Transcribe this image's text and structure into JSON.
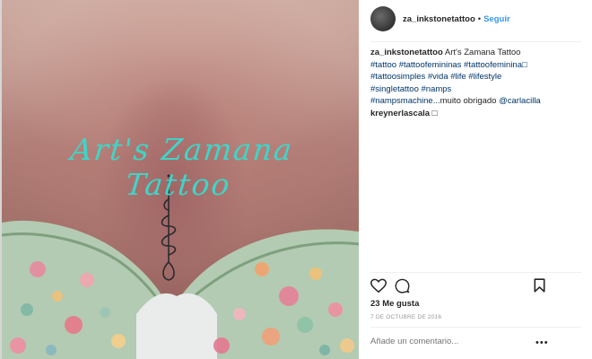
{
  "post": {
    "username": "za_inkstonetattoo",
    "separator": "•",
    "follow_label": "Seguir",
    "image_watermark": "Art's Zamana Tattoo",
    "caption": {
      "username": "za_inkstonetattoo",
      "text": "Art's Zamana Tattoo",
      "hashtags_line1": "#tattoo #tattoofemininas #tattoofeminina□",
      "hashtags_line2": "#tattoosimples #vida #life #lifestyle",
      "hashtags_line3": "#singletattoo #namps",
      "line4_tags": "#nampsmachine...",
      "line4_text": "muito obrigado ",
      "line4_mention": "@carlacilla"
    },
    "comment": {
      "username": "kreynerlascala",
      "text": "□"
    },
    "likes": "23 Me gusta",
    "date": "7 DE OCTUBRE DE 2016",
    "add_comment_placeholder": "Añade un comentario...",
    "more_options": "•••",
    "icons": {
      "like": "heart-icon",
      "comment": "comment-icon",
      "save": "bookmark-icon",
      "more": "ellipsis-icon"
    },
    "colors": {
      "link_blue": "#3897f0",
      "hashtag": "#003569",
      "muted": "#999999",
      "watermark": "#3dd6c9"
    }
  }
}
